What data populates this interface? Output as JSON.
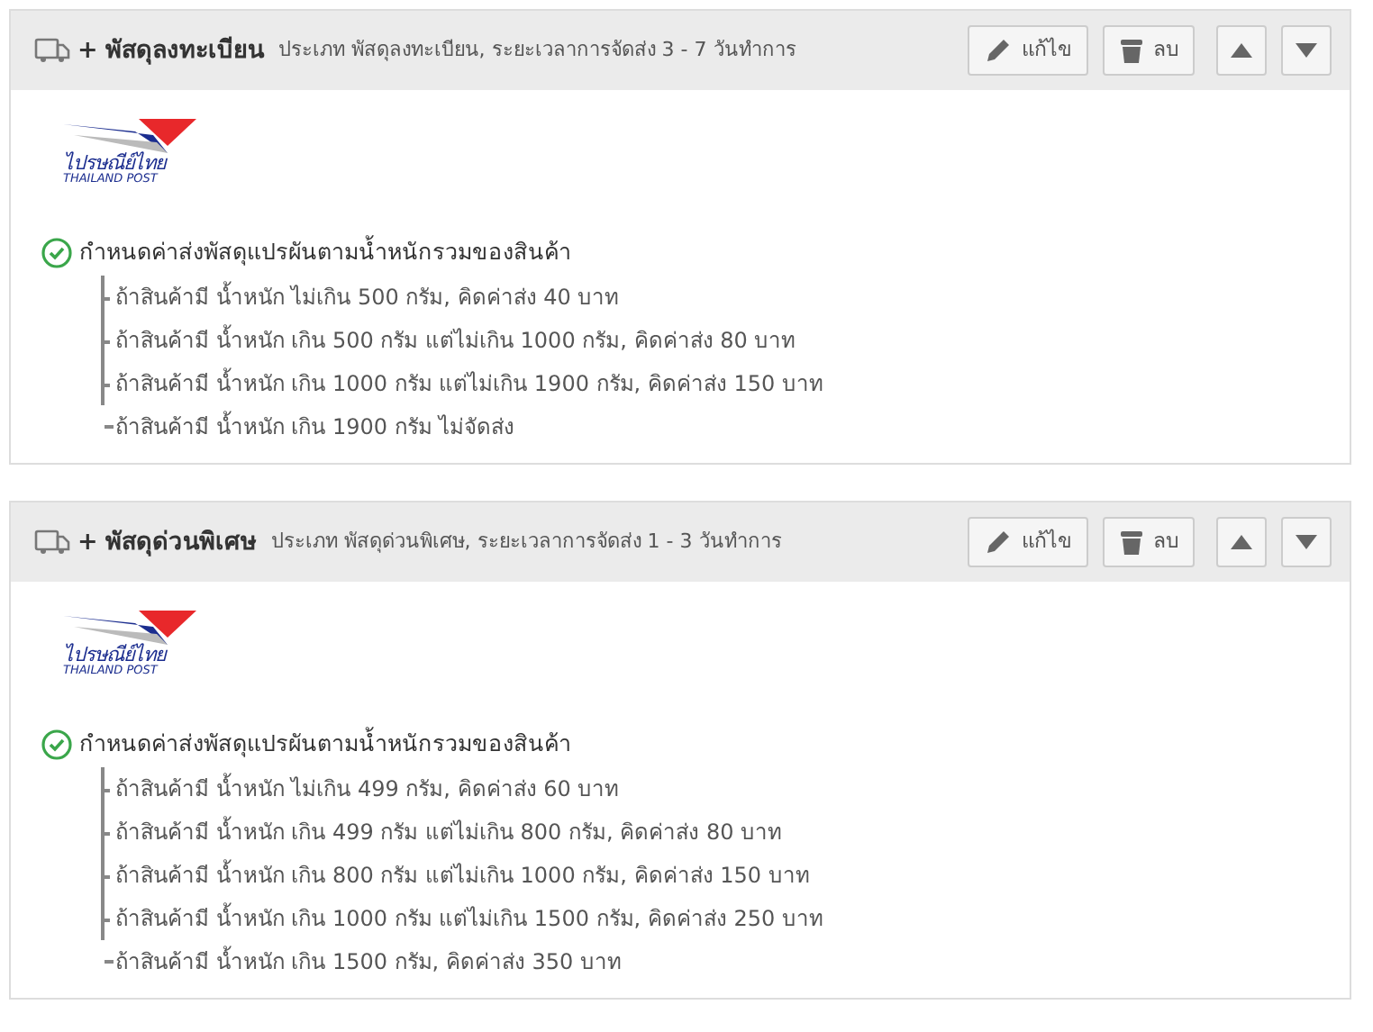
{
  "shipping_methods": [
    {
      "prefix": "+",
      "name": "พัสดุลงทะเบียน",
      "description": "ประเภท พัสดุลงทะเบียน, ระยะเวลาการจัดส่ง 3 - 7 วันทำการ",
      "buttons": [
        {
          "kind": "edit",
          "label": "แก้ไข"
        },
        {
          "kind": "delete",
          "label": "ลบ"
        },
        {
          "kind": "up"
        },
        {
          "kind": "down"
        }
      ],
      "logo": {
        "thai": "ไปรษณีย์ไทย",
        "english": "THAILAND POST"
      },
      "rule": {
        "checked": true,
        "title": "กำหนดค่าส่งพัสดุแปรผันตามน้ำหนักรวมของสินค้า",
        "items": [
          "ถ้าสินค้ามี น้ำหนัก ไม่เกิน 500 กรัม, คิดค่าส่ง 40 บาท",
          "ถ้าสินค้ามี น้ำหนัก เกิน 500 กรัม แต่ไม่เกิน 1000 กรัม, คิดค่าส่ง 80 บาท",
          "ถ้าสินค้ามี น้ำหนัก เกิน 1000 กรัม แต่ไม่เกิน 1900 กรัม, คิดค่าส่ง 150 บาท",
          "ถ้าสินค้ามี น้ำหนัก เกิน 1900 กรัม ไม่จัดส่ง"
        ]
      }
    },
    {
      "prefix": "+",
      "name": "พัสดุด่วนพิเศษ",
      "description": "ประเภท พัสดุด่วนพิเศษ, ระยะเวลาการจัดส่ง 1 - 3 วันทำการ",
      "buttons": [
        {
          "kind": "edit",
          "label": "แก้ไข"
        },
        {
          "kind": "delete",
          "label": "ลบ"
        },
        {
          "kind": "up"
        },
        {
          "kind": "down"
        }
      ],
      "logo": {
        "thai": "ไปรษณีย์ไทย",
        "english": "THAILAND POST"
      },
      "rule": {
        "checked": true,
        "title": "กำหนดค่าส่งพัสดุแปรผันตามน้ำหนักรวมของสินค้า",
        "items": [
          "ถ้าสินค้ามี น้ำหนัก ไม่เกิน 499 กรัม, คิดค่าส่ง 60 บาท",
          "ถ้าสินค้ามี น้ำหนัก เกิน 499 กรัม แต่ไม่เกิน 800 กรัม, คิดค่าส่ง 80 บาท",
          "ถ้าสินค้ามี น้ำหนัก เกิน 800 กรัม แต่ไม่เกิน 1000 กรัม, คิดค่าส่ง 150 บาท",
          "ถ้าสินค้ามี น้ำหนัก เกิน 1000 กรัม แต่ไม่เกิน 1500 กรัม, คิดค่าส่ง 250 บาท",
          "ถ้าสินค้ามี น้ำหนัก เกิน 1500 กรัม, คิดค่าส่ง 350 บาท"
        ]
      }
    }
  ]
}
